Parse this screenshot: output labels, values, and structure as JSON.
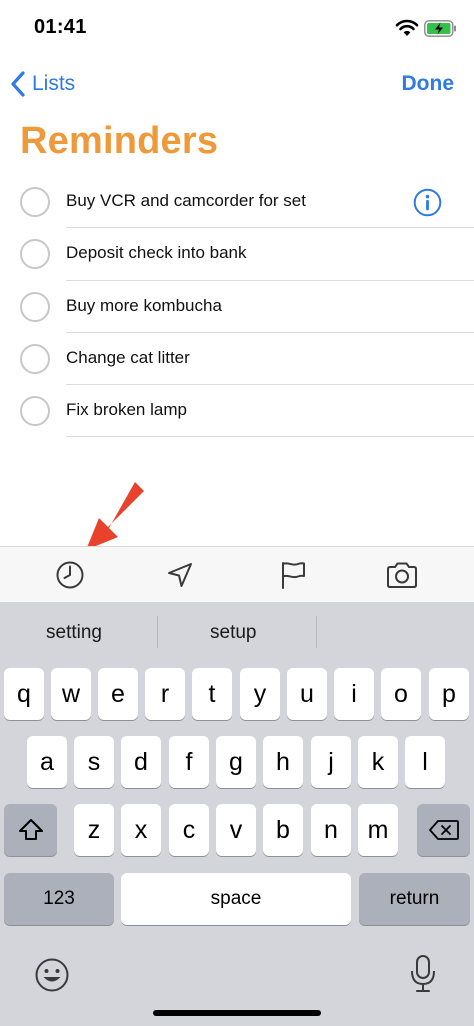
{
  "status_bar": {
    "time": "01:41",
    "wifi_icon": "wifi-icon",
    "battery_icon": "battery-charging-icon"
  },
  "nav": {
    "back_label": "Lists",
    "done_label": "Done"
  },
  "list": {
    "title": "Reminders",
    "title_color": "#ee9a3a",
    "items": [
      {
        "text": "Buy VCR and camcorder for set",
        "has_info": true
      },
      {
        "text": "Deposit check into bank"
      },
      {
        "text": "Buy more kombucha"
      },
      {
        "text": "Change cat litter"
      },
      {
        "text": "Fix broken lamp"
      }
    ]
  },
  "toolbar": {
    "icons": [
      "clock-icon",
      "location-arrow-icon",
      "flag-icon",
      "camera-icon"
    ],
    "highlight": "red-arrow"
  },
  "keyboard": {
    "suggestions": [
      "setting",
      "setup",
      ""
    ],
    "row1": [
      "q",
      "w",
      "e",
      "r",
      "t",
      "y",
      "u",
      "i",
      "o",
      "p"
    ],
    "row2": [
      "a",
      "s",
      "d",
      "f",
      "g",
      "h",
      "j",
      "k",
      "l"
    ],
    "row3": [
      "z",
      "x",
      "c",
      "v",
      "b",
      "n",
      "m"
    ],
    "numbers_label": "123",
    "space_label": "space",
    "return_label": "return"
  },
  "colors": {
    "accent": "#2f7ae5",
    "arrow": "#e8422c",
    "keyboard_bg": "#d3d5da"
  }
}
